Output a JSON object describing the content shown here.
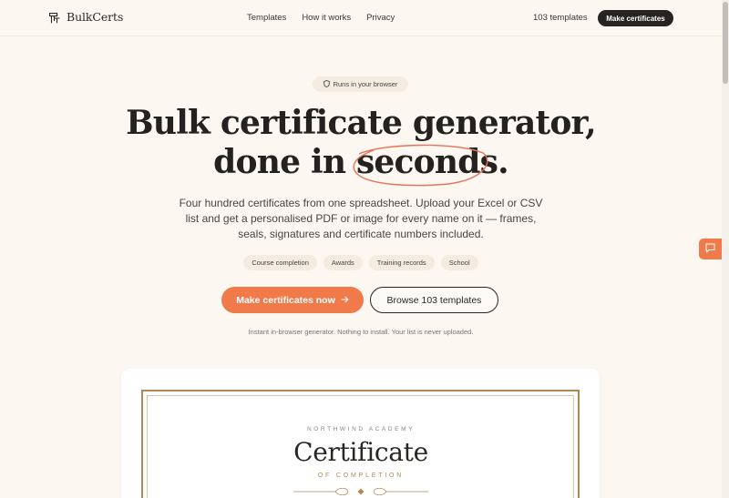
{
  "header": {
    "brand": "BulkCerts",
    "nav": [
      "Templates",
      "How it works",
      "Privacy"
    ],
    "template_count": "103 templates",
    "cta_label": "Make certificates"
  },
  "hero": {
    "badge": "Runs in your browser",
    "title_line1": "Bulk certificate generator,",
    "title_line2_prefix": "done in ",
    "title_highlight": "seconds",
    "title_line2_suffix": ".",
    "description": "Four hundred certificates from one spreadsheet. Upload your Excel or CSV list and get a personalised PDF or image for every name on it — frames, seals, signatures and certificate numbers included.",
    "tags": [
      "Course completion",
      "Awards",
      "Training records",
      "School"
    ],
    "primary_cta": "Make certificates now",
    "secondary_cta": "Browse 103 templates",
    "note": "Instant in-browser generator. Nothing to install. Your list is never uploaded."
  },
  "preview": {
    "academy": "NORTHWIND ACADEMY",
    "title": "Certificate",
    "subtitle": "OF COMPLETION"
  },
  "colors": {
    "accent": "#f17a4a",
    "background": "#fcf7f1",
    "gold": "#b08a55",
    "dark": "#262321"
  },
  "icons": {
    "logo": "certificate-stack-icon",
    "badge": "shield-icon",
    "cta": "arrow-right-icon",
    "feedback": "chat-bubble-icon"
  }
}
